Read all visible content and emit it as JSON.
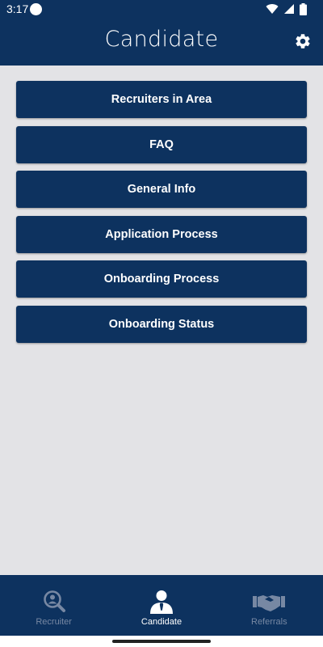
{
  "status_bar": {
    "time": "3:17",
    "icons": [
      "notification-dot-icon",
      "wifi-icon",
      "signal-icon",
      "battery-icon"
    ]
  },
  "app_bar": {
    "title": "Candidate",
    "settings_icon": "gear-icon"
  },
  "menu": {
    "items": [
      {
        "label": "Recruiters in Area"
      },
      {
        "label": "FAQ"
      },
      {
        "label": "General Info"
      },
      {
        "label": "Application Process"
      },
      {
        "label": "Onboarding Process"
      },
      {
        "label": "Onboarding Status"
      }
    ]
  },
  "bottom_nav": {
    "items": [
      {
        "label": "Recruiter",
        "icon": "magnifier-person-icon",
        "active": false
      },
      {
        "label": "Candidate",
        "icon": "person-tie-icon",
        "active": true
      },
      {
        "label": "Referrals",
        "icon": "handshake-icon",
        "active": false
      }
    ]
  },
  "colors": {
    "primary": "#0d325f",
    "background": "#e3e3e6",
    "active_text": "#ffffff",
    "inactive_text": "#7788a3"
  }
}
